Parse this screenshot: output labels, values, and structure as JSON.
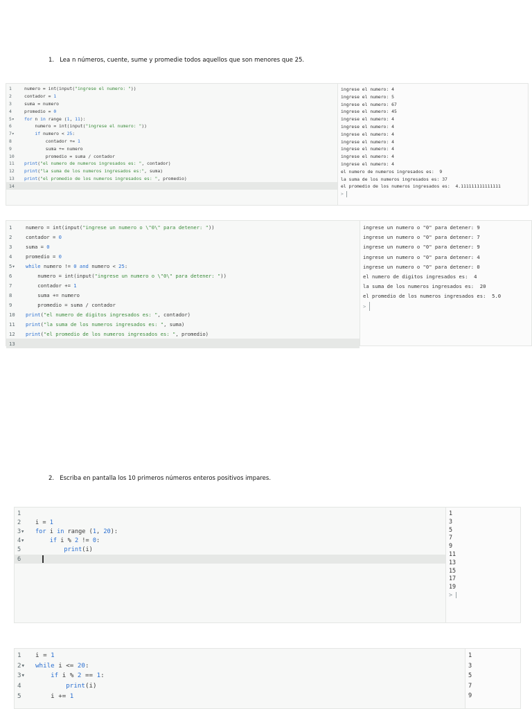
{
  "section1_title": "1.   Lea n números, cuente, sume y promedie todos aquellos que son menores que 25.",
  "section2_title": "2.   Escriba en pantalla los 10 primeros números enteros positivos impares.",
  "block1": {
    "lines": [
      {
        "n": "1",
        "code": "numero = int(input(\"ingrese el numero: \"))"
      },
      {
        "n": "2",
        "code": "contador = 1"
      },
      {
        "n": "3",
        "code": "suma = numero"
      },
      {
        "n": "4",
        "code": "promedio = 0"
      },
      {
        "n": "5▾",
        "code": "for n in range (1, 11):"
      },
      {
        "n": "6",
        "code": "    numero = int(input(\"ingrese el numero: \"))"
      },
      {
        "n": "7▾",
        "code": "    if numero < 25:"
      },
      {
        "n": "8",
        "code": "        contador += 1"
      },
      {
        "n": "9",
        "code": "        suma += numero"
      },
      {
        "n": "10",
        "code": "        promedio = suma / contador"
      },
      {
        "n": "11",
        "code": "print(\"el numero de numeros ingresados es: \", contador)"
      },
      {
        "n": "12",
        "code": "print(\"la suma de los numeros ingresados es:\", suma)"
      },
      {
        "n": "13",
        "code": "print(\"el promedio de los numeros ingresados es: \", promedio)"
      },
      {
        "n": "14",
        "code": ""
      }
    ],
    "output": [
      "ingrese el numero: 4",
      "ingrese el numero: 5",
      "ingrese el numero: 67",
      "ingrese el numero: 45",
      "ingrese el numero: 4",
      "ingrese el numero: 4",
      "ingrese el numero: 4",
      "ingrese el numero: 4",
      "ingrese el numero: 4",
      "ingrese el numero: 4",
      "ingrese el numero: 4",
      "el numero de numeros ingresados es:  9",
      "la suma de los numeros ingresados es: 37",
      "el promedio de los numeros ingresados es:  4.111111111111111"
    ],
    "prompt": ">"
  },
  "block2": {
    "lines": [
      {
        "n": "1",
        "code": "numero = int(input(\"ingrese un numero o \\\"0\\\" para detener: \"))"
      },
      {
        "n": "2",
        "code": "contador = 0"
      },
      {
        "n": "3",
        "code": "suma = 0"
      },
      {
        "n": "4",
        "code": "promedio = 0"
      },
      {
        "n": "5▾",
        "code": "while numero != 0 and numero < 25:"
      },
      {
        "n": "6",
        "code": "    numero = int(input(\"ingrese un numero o \\\"0\\\" para detener: \"))"
      },
      {
        "n": "7",
        "code": "    contador += 1"
      },
      {
        "n": "8",
        "code": "    suma += numero"
      },
      {
        "n": "9",
        "code": "    promedio = suma / contador"
      },
      {
        "n": "10",
        "code": "print(\"el numero de digitos ingresados es: \", contador)"
      },
      {
        "n": "11",
        "code": "print(\"la suma de los numeros ingresados es: \", suma)"
      },
      {
        "n": "12",
        "code": "print(\"el promedio de los numeros ingresados es: \", promedio)"
      },
      {
        "n": "13",
        "code": ""
      }
    ],
    "output": [
      "ingrese un numero o \"0\" para detener: 9",
      "ingrese un numero o \"0\" para detener: 7",
      "ingrese un numero o \"0\" para detener: 9",
      "ingrese un numero o \"0\" para detener: 4",
      "ingrese un numero o \"0\" para detener: 0",
      "el numero de digitos ingresados es:  4",
      "la suma de los numeros ingresados es:  20",
      "el promedio de los numeros ingresados es:  5.0"
    ],
    "prompt": ">"
  },
  "block3": {
    "lines": [
      {
        "n": "1",
        "code": ""
      },
      {
        "n": "2",
        "code": "i = 1"
      },
      {
        "n": "3▾",
        "code": "for i in range (1, 20):"
      },
      {
        "n": "4▾",
        "code": "    if i % 2 != 0:"
      },
      {
        "n": "5",
        "code": "        print(i)"
      },
      {
        "n": "6",
        "code": ""
      }
    ],
    "output": [
      "1",
      "3",
      "5",
      "7",
      "9",
      "11",
      "13",
      "15",
      "17",
      "19"
    ],
    "prompt": ">"
  },
  "block4": {
    "lines": [
      {
        "n": "1",
        "code": "i = 1"
      },
      {
        "n": "2▾",
        "code": "while i <= 20:"
      },
      {
        "n": "3▾",
        "code": "    if i % 2 == 1:"
      },
      {
        "n": "4",
        "code": "        print(i)"
      },
      {
        "n": "5",
        "code": "    i += 1"
      }
    ],
    "output": [
      "1",
      "3",
      "5",
      "7",
      "9"
    ]
  }
}
